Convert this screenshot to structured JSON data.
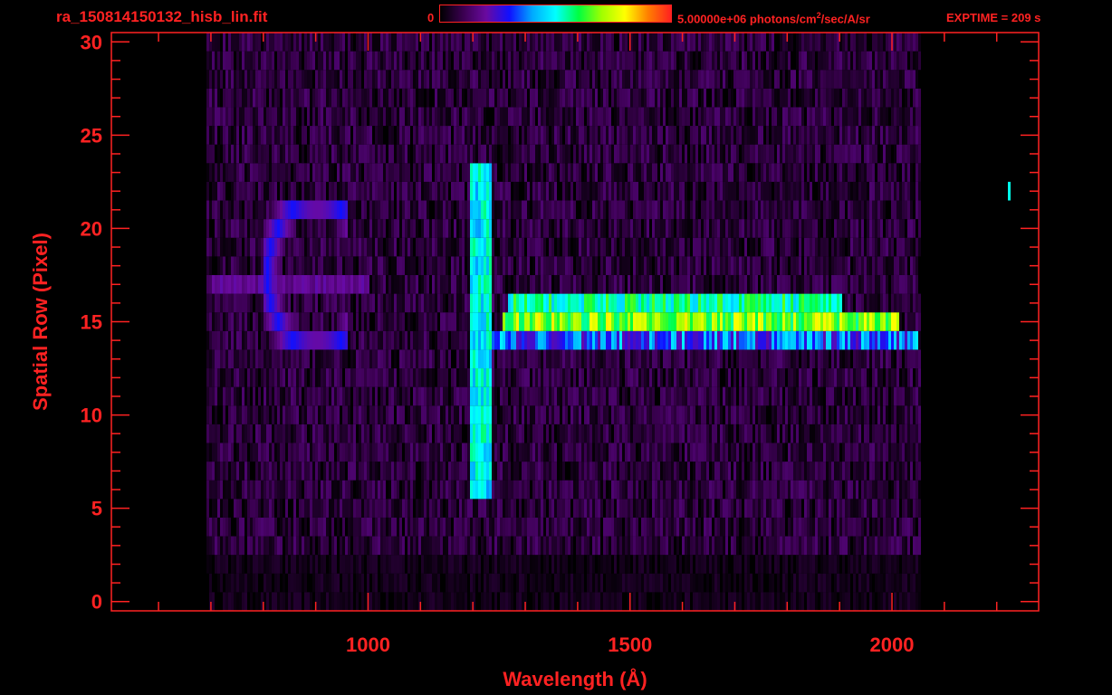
{
  "header": {
    "filename": "ra_150814150132_hisb_lin.fit",
    "colorbar_min": "0",
    "colorbar_max_prefix": "5.00000e+06 photons/cm",
    "colorbar_max_sup": "2",
    "colorbar_max_suffix": "/sec/A/sr",
    "exptime": "EXPTIME = 209 s"
  },
  "colors": {
    "axis": "#ff2222",
    "background": "#000000",
    "colormap": [
      "#000000",
      "#3a0050",
      "#6a0aa0",
      "#1010ff",
      "#00aaff",
      "#00ffff",
      "#00ff40",
      "#a0ff00",
      "#ffff00",
      "#ff8000",
      "#ff2020"
    ]
  },
  "chart_data": {
    "type": "heatmap",
    "title": "",
    "xlabel": "Wavelength (Å)",
    "ylabel": "Spatial Row (Pixel)",
    "xlim": [
      510,
      2280
    ],
    "ylim": [
      -0.5,
      30.5
    ],
    "x_ticks": [
      1000,
      1500,
      2000
    ],
    "y_ticks": [
      0,
      5,
      10,
      15,
      20,
      25,
      30
    ],
    "colorbar_range": [
      0,
      5000000
    ],
    "features": [
      {
        "name": "Lyman-alpha line",
        "x_range": [
          1190,
          1235
        ],
        "y_range": [
          6,
          23
        ],
        "level": 0.48
      },
      {
        "name": "band row 16",
        "x_range": [
          1265,
          1900
        ],
        "y_range": [
          16,
          16
        ],
        "level": 0.55
      },
      {
        "name": "band row 15",
        "x_range": [
          1255,
          2010
        ],
        "y_range": [
          15,
          15
        ],
        "level": 0.68
      },
      {
        "name": "band row 14",
        "x_range": [
          1235,
          2050
        ],
        "y_range": [
          14,
          14
        ],
        "level": 0.35
      },
      {
        "name": "diffuse row 17",
        "x_range": [
          700,
          1000
        ],
        "y_range": [
          17,
          17
        ],
        "level": 0.18
      },
      {
        "name": "arc feature",
        "x_range": [
          800,
          960
        ],
        "y_range": [
          14,
          21
        ],
        "level": 0.25
      },
      {
        "name": "hot pixel",
        "x_range": [
          2218,
          2224
        ],
        "y_range": [
          22,
          22
        ],
        "level": 0.5
      }
    ]
  }
}
